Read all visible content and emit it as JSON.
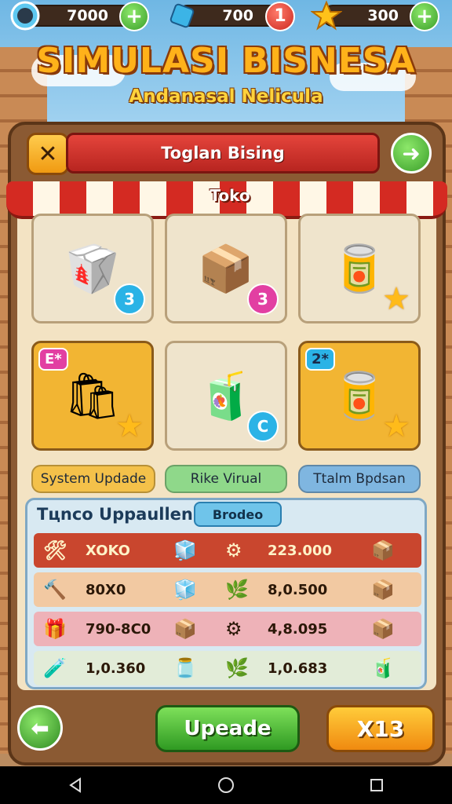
{
  "topbar": {
    "coins": {
      "value": "7000",
      "icon": "coin-icon"
    },
    "gems": {
      "value": "700",
      "icon": "gem-icon",
      "notification": "1"
    },
    "stars": {
      "value": "300",
      "icon": "star-icon"
    }
  },
  "title": {
    "main": "SIMULASI BISNESA",
    "subtitle": "Andanasal Nelicula"
  },
  "panel": {
    "header": "Toglan Bising",
    "awning_label": "Toko"
  },
  "tiles": [
    {
      "product": "snack-box",
      "badge": "3",
      "badge_style": "blue"
    },
    {
      "product": "food-box",
      "badge": "3",
      "badge_style": "pink"
    },
    {
      "product": "canned-goods",
      "badge": "★",
      "badge_style": "star"
    },
    {
      "product": "grocery-set",
      "badge": "★",
      "badge_style": "star",
      "tag": "E*"
    },
    {
      "product": "packaged-foods",
      "badge": "C",
      "badge_style": "blue"
    },
    {
      "product": "cans-and-boxes",
      "badge": "★",
      "badge_style": "star",
      "tag": "2*"
    }
  ],
  "categories": [
    {
      "label": "System Updade",
      "color": "#f4c14a"
    },
    {
      "label": "Rike Virual",
      "color": "#8fd88a"
    },
    {
      "label": "Ttalm Bpdsan",
      "color": "#7fb6e0"
    }
  ],
  "upgrades": {
    "title": "Tцnco Uppaullen",
    "tab": "Brodeo",
    "rows": [
      {
        "name": "XOKO",
        "value": "223.000",
        "bg": "#c9462e",
        "text_color": "#fff3c8"
      },
      {
        "name": "80X0",
        "value": "8,0.500",
        "bg": "#f2c9a2",
        "text_color": "#2b1808"
      },
      {
        "name": "790-8C0",
        "value": "4,8.095",
        "bg": "#eeb2b8",
        "text_color": "#2b1808"
      },
      {
        "name": "1,0.360",
        "value": "1,0.683",
        "bg": "#e2ecd8",
        "text_color": "#2b1808"
      }
    ]
  },
  "bottom": {
    "upgrade_label": "Upeade",
    "multiplier_label": "X13"
  }
}
